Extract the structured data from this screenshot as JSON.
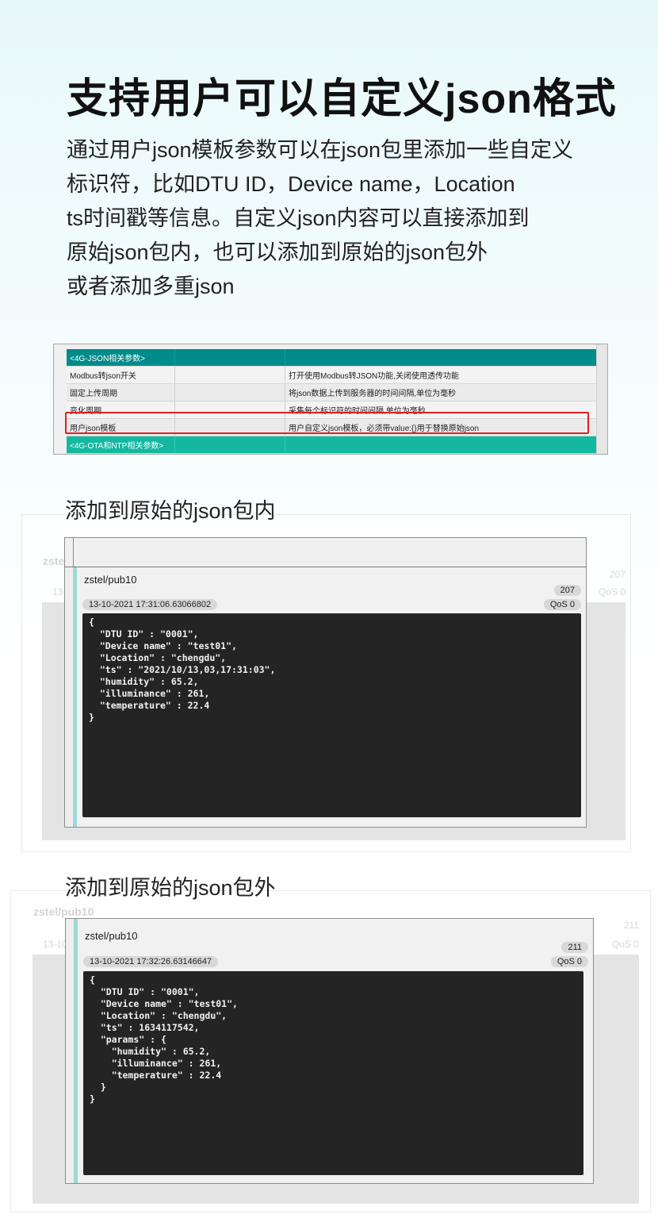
{
  "title": "支持用户可以自定义json格式",
  "description_lines": [
    "通过用户json模板参数可以在json包里添加一些自定义",
    "标识符，比如DTU ID，Device name，Location",
    "ts时间戳等信息。自定义json内容可以直接添加到",
    "原始json包内，也可以添加到原始的json包外",
    "或者添加多重json"
  ],
  "param_table": {
    "section_header": "<4G-JSON相关参数>",
    "rows": [
      {
        "name": "Modbus转json开关",
        "desc": "打开使用Modbus转JSON功能,关闭使用透传功能"
      },
      {
        "name": "固定上传周期",
        "desc": "将json数据上传到服务器的时间间隔,单位为毫秒"
      },
      {
        "name": "变化周期",
        "desc": "采集每个标识符的时间间隔,单位为毫秒"
      },
      {
        "name": "用户json模板",
        "desc": "用户自定义json模板，必须带value:{}用于替换原始json"
      }
    ],
    "next_section": "<4G-OTA和NTP相关参数>"
  },
  "inner": {
    "subtitle": "添加到原始的json包内",
    "ghost_topic": "zstel",
    "ghost_date": "13-",
    "ghost_count": "207",
    "ghost_qos": "QoS 0",
    "topic": "zstel/pub10",
    "count": "207",
    "timestamp": "13-10-2021  17:31:06.63066802",
    "qos": "QoS 0",
    "code": "{\n  \"DTU ID\" : \"0001\",\n  \"Device name\" : \"test01\",\n  \"Location\" : \"chengdu\",\n  \"ts\" : \"2021/10/13,03,17:31:03\",\n  \"humidity\" : 65.2,\n  \"illuminance\" : 261,\n  \"temperature\" : 22.4\n}"
  },
  "outer": {
    "subtitle": "添加到原始的json包外",
    "ghost_topic": "zstel/pub10",
    "ghost_date": "13-10",
    "ghost_count": "211",
    "ghost_qos": "QoS 0",
    "topic": "zstel/pub10",
    "count": "211",
    "timestamp": "13-10-2021  17:32:26.63146647",
    "qos": "QoS 0",
    "code": "{\n  \"DTU ID\" : \"0001\",\n  \"Device name\" : \"test01\",\n  \"Location\" : \"chengdu\",\n  \"ts\" : 1634117542,\n  \"params\" : {\n    \"humidity\" : 65.2,\n    \"illuminance\" : 261,\n    \"temperature\" : 22.4\n  }\n}"
  },
  "colors": {
    "section_teal": "#008b8b",
    "section_teal2": "#14b8a0",
    "highlight_red": "#e02020",
    "code_bg": "#242424"
  }
}
